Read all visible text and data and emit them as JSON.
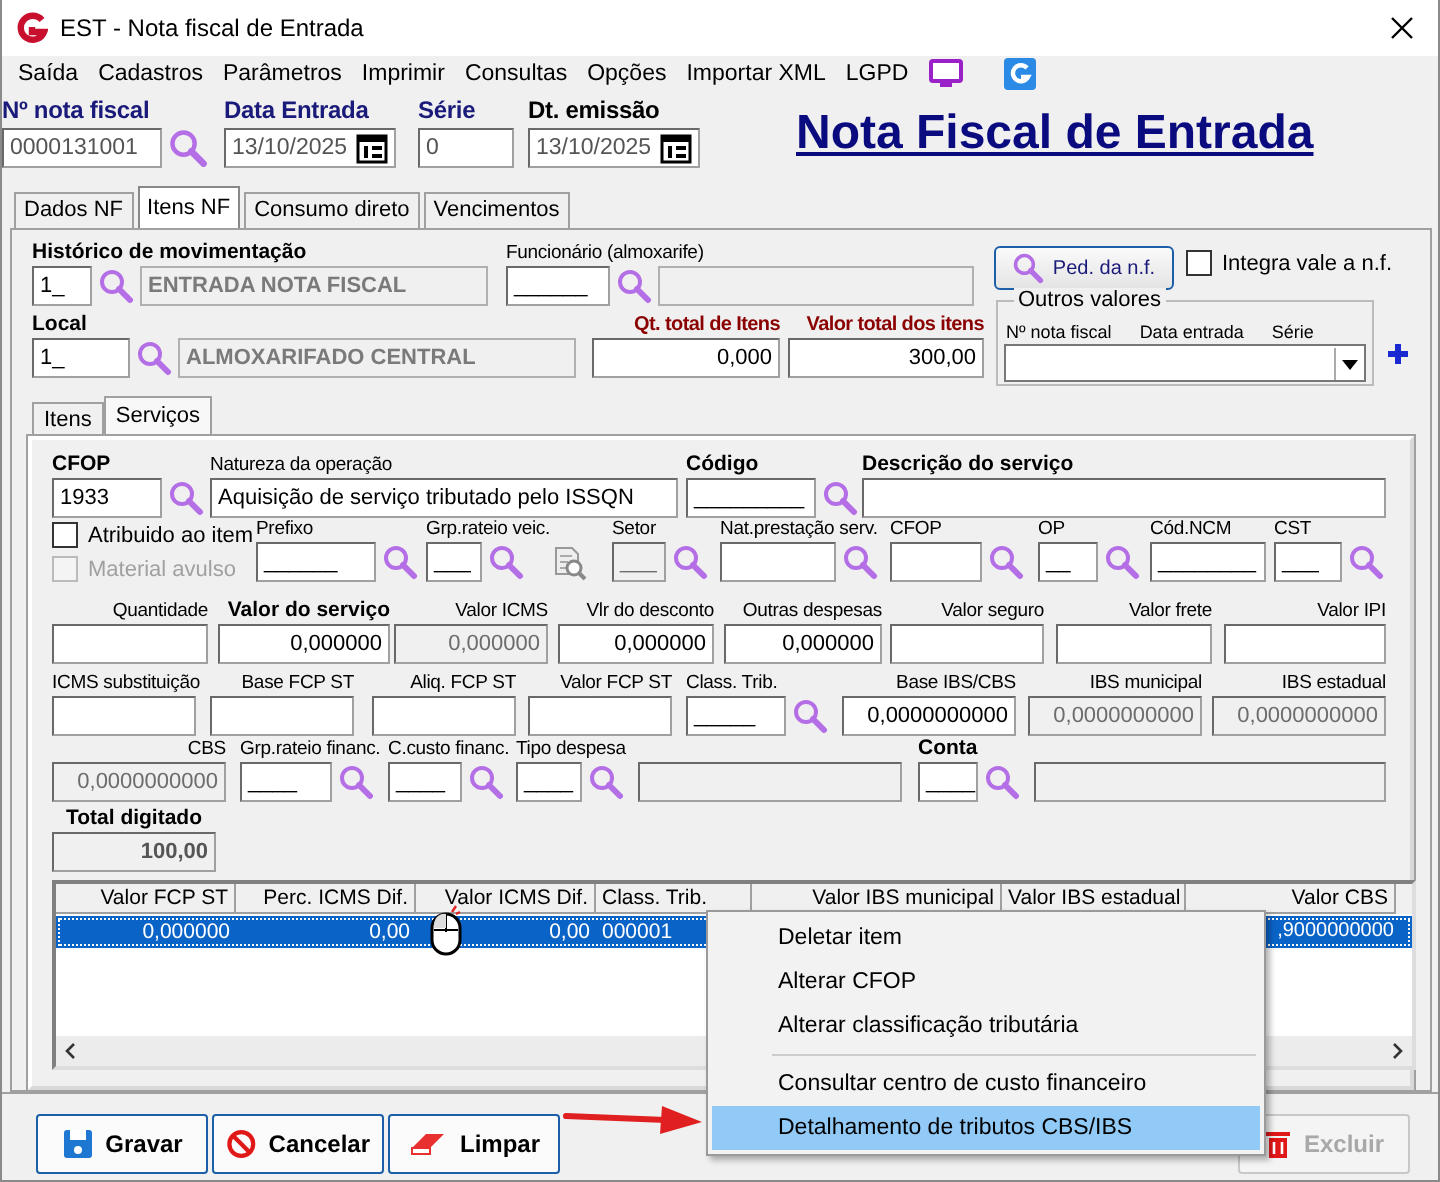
{
  "window": {
    "title": "EST - Nota fiscal de Entrada"
  },
  "menu": [
    "Saída",
    "Cadastros",
    "Parâmetros",
    "Imprimir",
    "Consultas",
    "Opções",
    "Importar XML",
    "LGPD"
  ],
  "header": {
    "fields": [
      {
        "label": "Nº nota fiscal",
        "value": "0000131001",
        "kind": "lookup",
        "accent": true
      },
      {
        "label": "Data Entrada",
        "value": "13/10/2025",
        "kind": "date",
        "accent": true
      },
      {
        "label": "Série",
        "value": "0",
        "kind": "text",
        "accent": true
      },
      {
        "label": "Dt. emissão",
        "value": "13/10/2025",
        "kind": "date",
        "accent": false
      }
    ],
    "heading": "Nota Fiscal de Entrada"
  },
  "tabs": [
    {
      "label": "Dados NF",
      "selected": false
    },
    {
      "label": "Itens NF",
      "selected": true
    },
    {
      "label": "Consumo direto",
      "selected": false
    },
    {
      "label": "Vencimentos",
      "selected": false
    }
  ],
  "general": {
    "historico": {
      "label": "Histórico de movimentação",
      "code": "1_",
      "description": "ENTRADA NOTA FISCAL"
    },
    "funcionario": {
      "label": "Funcionário (almoxarife)",
      "code": "______"
    },
    "order_button": "Ped. da n.f.",
    "integra": {
      "label": "Integra vale a n.f.",
      "checked": false
    },
    "local": {
      "label": "Local",
      "code": "1_",
      "description": "ALMOXARIFADO CENTRAL"
    },
    "totals": [
      {
        "label": "Qt. total de Itens",
        "value": "0,000"
      },
      {
        "label": "Valor total dos itens",
        "value": "300,00"
      }
    ],
    "outros_valores": {
      "title": "Outros valores",
      "columns": [
        "Nº nota fiscal",
        "Data entrada",
        "Série"
      ]
    }
  },
  "subtabs": [
    {
      "label": "Itens",
      "selected": false
    },
    {
      "label": "Serviços",
      "selected": true
    }
  ],
  "servico": {
    "lines": [
      {
        "fields": [
          {
            "kind": "lookup",
            "label": "CFOP",
            "bold": true,
            "value": "1933"
          },
          {
            "kind": "text",
            "label": "Natureza da operação",
            "bold": false,
            "value": "Aquisição de serviço tributado pelo ISSQN"
          },
          {
            "kind": "lookup",
            "label": "Código",
            "bold": true,
            "value": "_________"
          },
          {
            "kind": "text",
            "label": "Descrição do serviço",
            "bold": true
          }
        ]
      },
      {
        "fields": [
          {
            "kind": "checks",
            "checks": [
              {
                "label": "Atribuido ao item",
                "checked": false,
                "disabled": false
              },
              {
                "label": "Material avulso",
                "checked": false,
                "disabled": true
              }
            ]
          },
          {
            "kind": "lookup",
            "label": "Prefixo",
            "bold": false,
            "value": "______"
          },
          {
            "kind": "lookup",
            "label": "Grp.rateio veic.",
            "bold": false,
            "value": "___"
          },
          {
            "kind": "tool"
          },
          {
            "kind": "readonly_lookup",
            "label": "Setor",
            "bold": false,
            "value": "___"
          },
          {
            "kind": "lookup",
            "label": "Nat.prestação serv.",
            "bold": false
          },
          {
            "kind": "lookup",
            "label": "CFOP",
            "bold": false
          },
          {
            "kind": "lookup",
            "label": "OP",
            "bold": false,
            "value": "__"
          },
          {
            "kind": "text",
            "label": "Cód.NCM",
            "bold": false,
            "value": "________"
          },
          {
            "kind": "lookup",
            "label": "CST",
            "bold": false,
            "value": "___"
          }
        ]
      },
      {
        "fields": [
          {
            "kind": "number",
            "label": "Quantidade",
            "bold": false
          },
          {
            "kind": "number",
            "label": "Valor do serviço",
            "bold": true,
            "value": "0,000000"
          },
          {
            "kind": "readonly_number",
            "label": "Valor ICMS",
            "bold": false,
            "value": "0,000000"
          },
          {
            "kind": "number",
            "label": "Vlr do desconto",
            "bold": false,
            "value": "0,000000"
          },
          {
            "kind": "number",
            "label": "Outras despesas",
            "bold": false,
            "value": "0,000000"
          },
          {
            "kind": "number",
            "label": "Valor seguro",
            "bold": false
          },
          {
            "kind": "number",
            "label": "Valor frete",
            "bold": false
          },
          {
            "kind": "number",
            "label": "Valor IPI",
            "bold": false
          }
        ]
      },
      {
        "fields": [
          {
            "kind": "text",
            "label": "ICMS substituição",
            "bold": false
          },
          {
            "kind": "number",
            "label": "Base FCP ST",
            "bold": false
          },
          {
            "kind": "number",
            "label": "Aliq. FCP ST",
            "bold": false
          },
          {
            "kind": "number",
            "label": "Valor FCP ST",
            "bold": false
          },
          {
            "kind": "lookup",
            "label": "Class. Trib.",
            "bold": false,
            "value": "_____"
          },
          {
            "kind": "number",
            "label": "Base IBS/CBS",
            "bold": false,
            "value": "0,0000000000"
          },
          {
            "kind": "readonly_number",
            "label": "IBS municipal",
            "bold": false,
            "value": "0,0000000000"
          },
          {
            "kind": "readonly_number",
            "label": "IBS estadual",
            "bold": false,
            "value": "0,0000000000"
          }
        ]
      },
      {
        "fields": [
          {
            "kind": "readonly_number",
            "label": "CBS",
            "bold": false,
            "value": "0,0000000000"
          },
          {
            "kind": "lookup",
            "label": "Grp.rateio financ.",
            "bold": false,
            "value": "____"
          },
          {
            "kind": "lookup",
            "label": "C.custo financ.",
            "bold": false,
            "value": "____"
          },
          {
            "kind": "lookup",
            "label": "Tipo despesa",
            "bold": false,
            "value": "____"
          },
          {
            "kind": "readonly_text"
          },
          {
            "kind": "lookup",
            "label": "Conta",
            "bold": true,
            "value": "____"
          },
          {
            "kind": "readonly_text"
          }
        ]
      },
      {
        "fields": [
          {
            "kind": "total",
            "label": "Total digitado",
            "bold": true,
            "value": "100,00"
          }
        ]
      }
    ]
  },
  "grid": {
    "columns": [
      "Valor FCP ST",
      "Perc. ICMS Dif.",
      "Valor ICMS Dif.",
      "Class. Trib.",
      "Valor IBS municipal",
      "Valor IBS estadual",
      "Valor CBS"
    ],
    "rows": [
      {
        "selected": true,
        "cells": [
          "0,000000",
          "0,00",
          "0,00",
          "000001",
          null,
          null,
          ",9000000000"
        ]
      }
    ]
  },
  "context_menu": [
    {
      "kind": "item",
      "label": "Deletar item",
      "selected": false
    },
    {
      "kind": "item",
      "label": "Alterar CFOP",
      "selected": false
    },
    {
      "kind": "item",
      "label": "Alterar classificação tributária",
      "selected": false
    },
    {
      "kind": "separator"
    },
    {
      "kind": "item",
      "label": "Consultar centro de custo financeiro",
      "selected": false
    },
    {
      "kind": "item",
      "label": "Detalhamento de tributos CBS/IBS",
      "selected": true
    }
  ],
  "buttons": [
    {
      "kind": "save",
      "label": "Gravar",
      "disabled": false
    },
    {
      "kind": "cancel",
      "label": "Cancelar",
      "disabled": false
    },
    {
      "kind": "clear",
      "label": "Limpar",
      "disabled": false
    },
    {
      "kind": "delete",
      "label": "Excluir",
      "disabled": true
    }
  ]
}
